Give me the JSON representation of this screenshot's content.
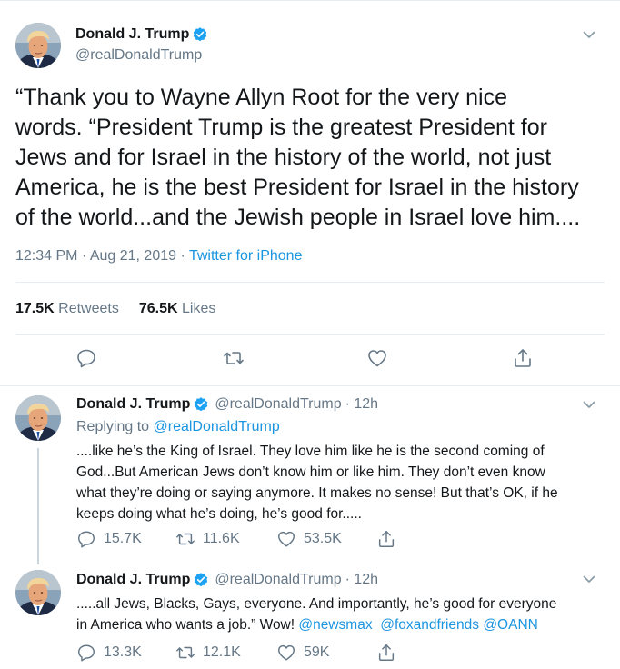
{
  "main_tweet": {
    "author_name": "Donald J. Trump",
    "author_handle": "@realDonaldTrump",
    "text_lines": [
      "“Thank you to Wayne Allyn Root for the very nice",
      "words. “President Trump is the greatest President for",
      "Jews and for Israel in the history of the world, not just",
      "America, he is the best President for Israel in the history",
      "of the world...and the Jewish people in Israel love him...."
    ],
    "time": "12:34 PM",
    "date": "Aug 21, 2019",
    "separator": "·",
    "source": "Twitter for iPhone",
    "retweets_count": "17.5K",
    "retweets_label": "Retweets",
    "likes_count": "76.5K",
    "likes_label": "Likes"
  },
  "replies": [
    {
      "author_name": "Donald J. Trump",
      "author_handle": "@realDonaldTrump",
      "age": "· 12h",
      "replying_prefix": "Replying to ",
      "replying_handle": "@realDonaldTrump",
      "text_lines": [
        "....like he’s the King of Israel. They love him like he is the second coming of",
        "God...But American Jews don’t know him or like him. They don’t even know",
        "what they’re doing or saying anymore. It makes no sense! But that’s OK, if he",
        "keeps doing what he’s doing, he’s good for....."
      ],
      "reply_count": "15.7K",
      "retweet_count": "11.6K",
      "like_count": "53.5K"
    },
    {
      "author_name": "Donald J. Trump",
      "author_handle": "@realDonaldTrump",
      "age": "· 12h",
      "text_line_1": ".....all Jews, Blacks, Gays, everyone. And importantly, he’s good for everyone",
      "text_line_2_prefix": "in America who wants a job.” Wow! ",
      "mentions": [
        "@newsmax",
        "@foxandfriends",
        "@OANN"
      ],
      "reply_count": "13.3K",
      "retweet_count": "12.1K",
      "like_count": "59K"
    }
  ],
  "icons": {
    "caret": "chevron-down-icon",
    "verified": "verified-badge-icon",
    "reply": "reply-icon",
    "retweet": "retweet-icon",
    "like": "heart-icon",
    "share": "share-icon"
  },
  "colors": {
    "text": "#14171a",
    "secondary": "#657786",
    "link": "#1b95e0",
    "verified": "#1da1f2",
    "border": "#e6ecf0"
  }
}
